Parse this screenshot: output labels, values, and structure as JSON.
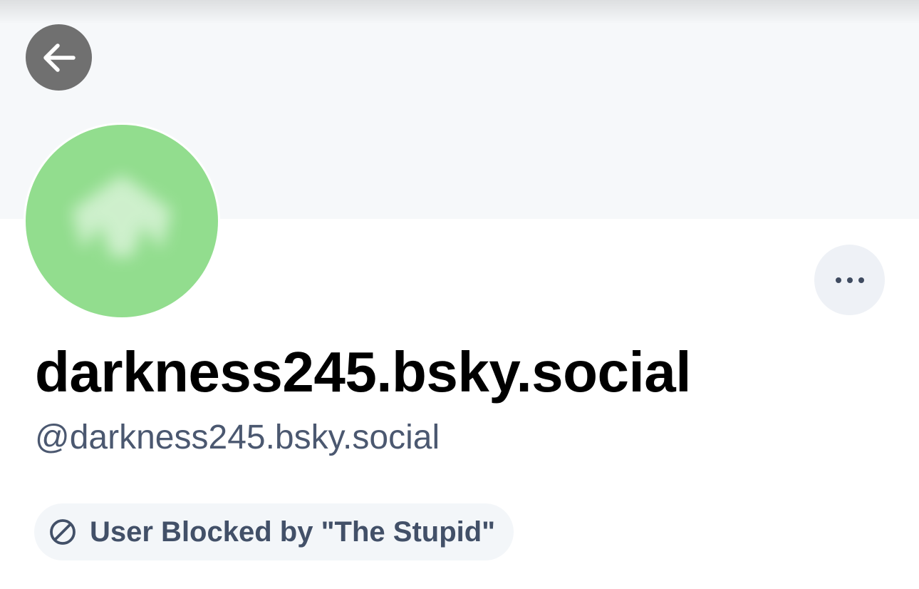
{
  "profile": {
    "display_name": "darkness245.bsky.social",
    "handle": "@darkness245.bsky.social",
    "blocked_label": "User Blocked by \"The Stupid\""
  },
  "icons": {
    "back": "arrow-left-icon",
    "more": "ellipsis-icon",
    "blocked": "block-circle-icon"
  },
  "colors": {
    "banner": "#f6f8fa",
    "avatar": "#92dd8e",
    "back_button": "#707070",
    "more_button": "#eef1f6",
    "handle_text": "#4b5870",
    "blocked_text": "#425068",
    "blocked_pill": "#f3f6f9"
  }
}
